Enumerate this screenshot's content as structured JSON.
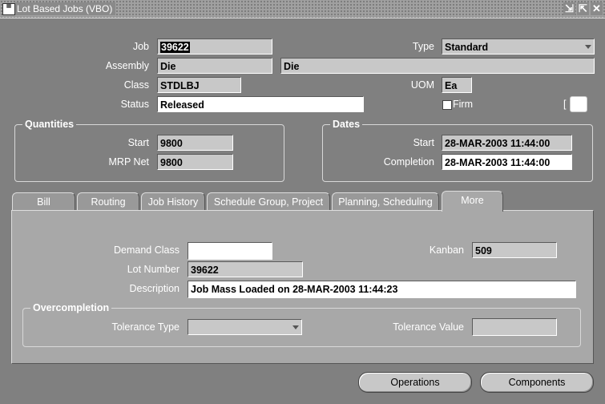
{
  "window": {
    "title": "Lot Based Jobs (VBO)",
    "icon": "app-icon"
  },
  "header": {
    "job_label": "Job",
    "job_value": "39622",
    "type_label": "Type",
    "type_value": "Standard",
    "assembly_label": "Assembly",
    "assembly_value": "Die",
    "assembly_desc": "Die",
    "class_label": "Class",
    "class_value": "STDLBJ",
    "uom_label": "UOM",
    "uom_value": "Ea",
    "status_label": "Status",
    "status_value": "Released",
    "firm_label": "Firm",
    "bracket_text": "["
  },
  "quantities": {
    "title": "Quantities",
    "start_label": "Start",
    "start_value": "9800",
    "mrp_label": "MRP Net",
    "mrp_value": "9800"
  },
  "dates": {
    "title": "Dates",
    "start_label": "Start",
    "start_value": "28-MAR-2003 11:44:00",
    "completion_label": "Completion",
    "completion_value": "28-MAR-2003 11:44:00"
  },
  "tabs": [
    {
      "label": "Bill"
    },
    {
      "label": "Routing"
    },
    {
      "label": "Job History"
    },
    {
      "label": "Schedule Group, Project"
    },
    {
      "label": "Planning, Scheduling"
    },
    {
      "label": "More"
    }
  ],
  "more": {
    "demand_class_label": "Demand Class",
    "demand_class_value": "",
    "kanban_label": "Kanban",
    "kanban_value": "509",
    "lot_number_label": "Lot Number",
    "lot_number_value": "39622",
    "description_label": "Description",
    "description_value": "Job Mass Loaded on 28-MAR-2003 11:44:23",
    "overcompletion": {
      "title": "Overcompletion",
      "tolerance_type_label": "Tolerance Type",
      "tolerance_type_value": "",
      "tolerance_value_label": "Tolerance Value",
      "tolerance_value_value": ""
    }
  },
  "buttons": {
    "operations": "Operations",
    "components": "Components"
  }
}
